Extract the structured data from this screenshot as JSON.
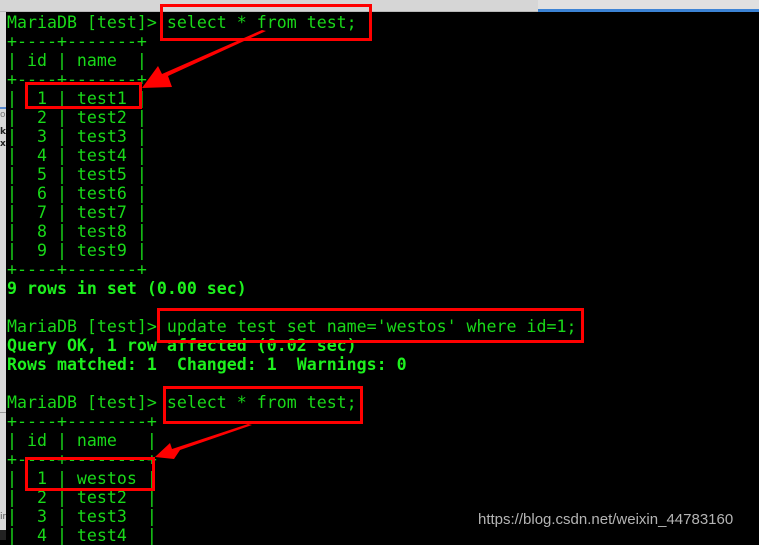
{
  "window": {
    "accent_color": "#3c83d4",
    "terminal_fg": "#19d919",
    "terminal_bg": "#000000",
    "annotation_color": "#ff0000"
  },
  "background_window": {
    "fragments": [
      "o",
      "k",
      "x",
      "ir"
    ]
  },
  "terminal": {
    "prompt": "MariaDB [test]>",
    "lines": [
      {
        "kind": "prompt",
        "command": "select * from test;"
      },
      {
        "kind": "text",
        "text": "+----+-------+"
      },
      {
        "kind": "text",
        "text": "| id | name  |"
      },
      {
        "kind": "text",
        "text": "+----+-------+"
      },
      {
        "kind": "text",
        "text": "|  1 | test1 |"
      },
      {
        "kind": "text",
        "text": "|  2 | test2 |"
      },
      {
        "kind": "text",
        "text": "|  3 | test3 |"
      },
      {
        "kind": "text",
        "text": "|  4 | test4 |"
      },
      {
        "kind": "text",
        "text": "|  5 | test5 |"
      },
      {
        "kind": "text",
        "text": "|  6 | test6 |"
      },
      {
        "kind": "text",
        "text": "|  7 | test7 |"
      },
      {
        "kind": "text",
        "text": "|  8 | test8 |"
      },
      {
        "kind": "text",
        "text": "|  9 | test9 |"
      },
      {
        "kind": "text",
        "text": "+----+-------+"
      },
      {
        "kind": "bold",
        "text": "9 rows in set (0.00 sec)"
      },
      {
        "kind": "text",
        "text": ""
      },
      {
        "kind": "prompt",
        "command": "update test set name='westos' where id=1;"
      },
      {
        "kind": "bold",
        "text": "Query OK, 1 row affected (0.02 sec)"
      },
      {
        "kind": "bold",
        "text": "Rows matched: 1  Changed: 1  Warnings: 0"
      },
      {
        "kind": "text",
        "text": ""
      },
      {
        "kind": "prompt",
        "command": "select * from test;"
      },
      {
        "kind": "text",
        "text": "+----+--------+"
      },
      {
        "kind": "text",
        "text": "| id | name   |"
      },
      {
        "kind": "text",
        "text": "+----+--------+"
      },
      {
        "kind": "text",
        "text": "|  1 | westos |"
      },
      {
        "kind": "text",
        "text": "|  2 | test2  |"
      },
      {
        "kind": "text",
        "text": "|  3 | test3  |"
      },
      {
        "kind": "text",
        "text": "|  4 | test4  |"
      }
    ]
  },
  "annotations": {
    "boxes": [
      {
        "label": "first-select-command"
      },
      {
        "label": "row-1-before-update"
      },
      {
        "label": "update-command"
      },
      {
        "label": "second-select-command"
      },
      {
        "label": "row-1-after-update"
      }
    ],
    "arrows": [
      {
        "from": "first-select-command",
        "to": "row-1-before-update"
      },
      {
        "from": "second-select-command",
        "to": "row-1-after-update"
      }
    ]
  },
  "watermark": "https://blog.csdn.net/weixin_44783160"
}
